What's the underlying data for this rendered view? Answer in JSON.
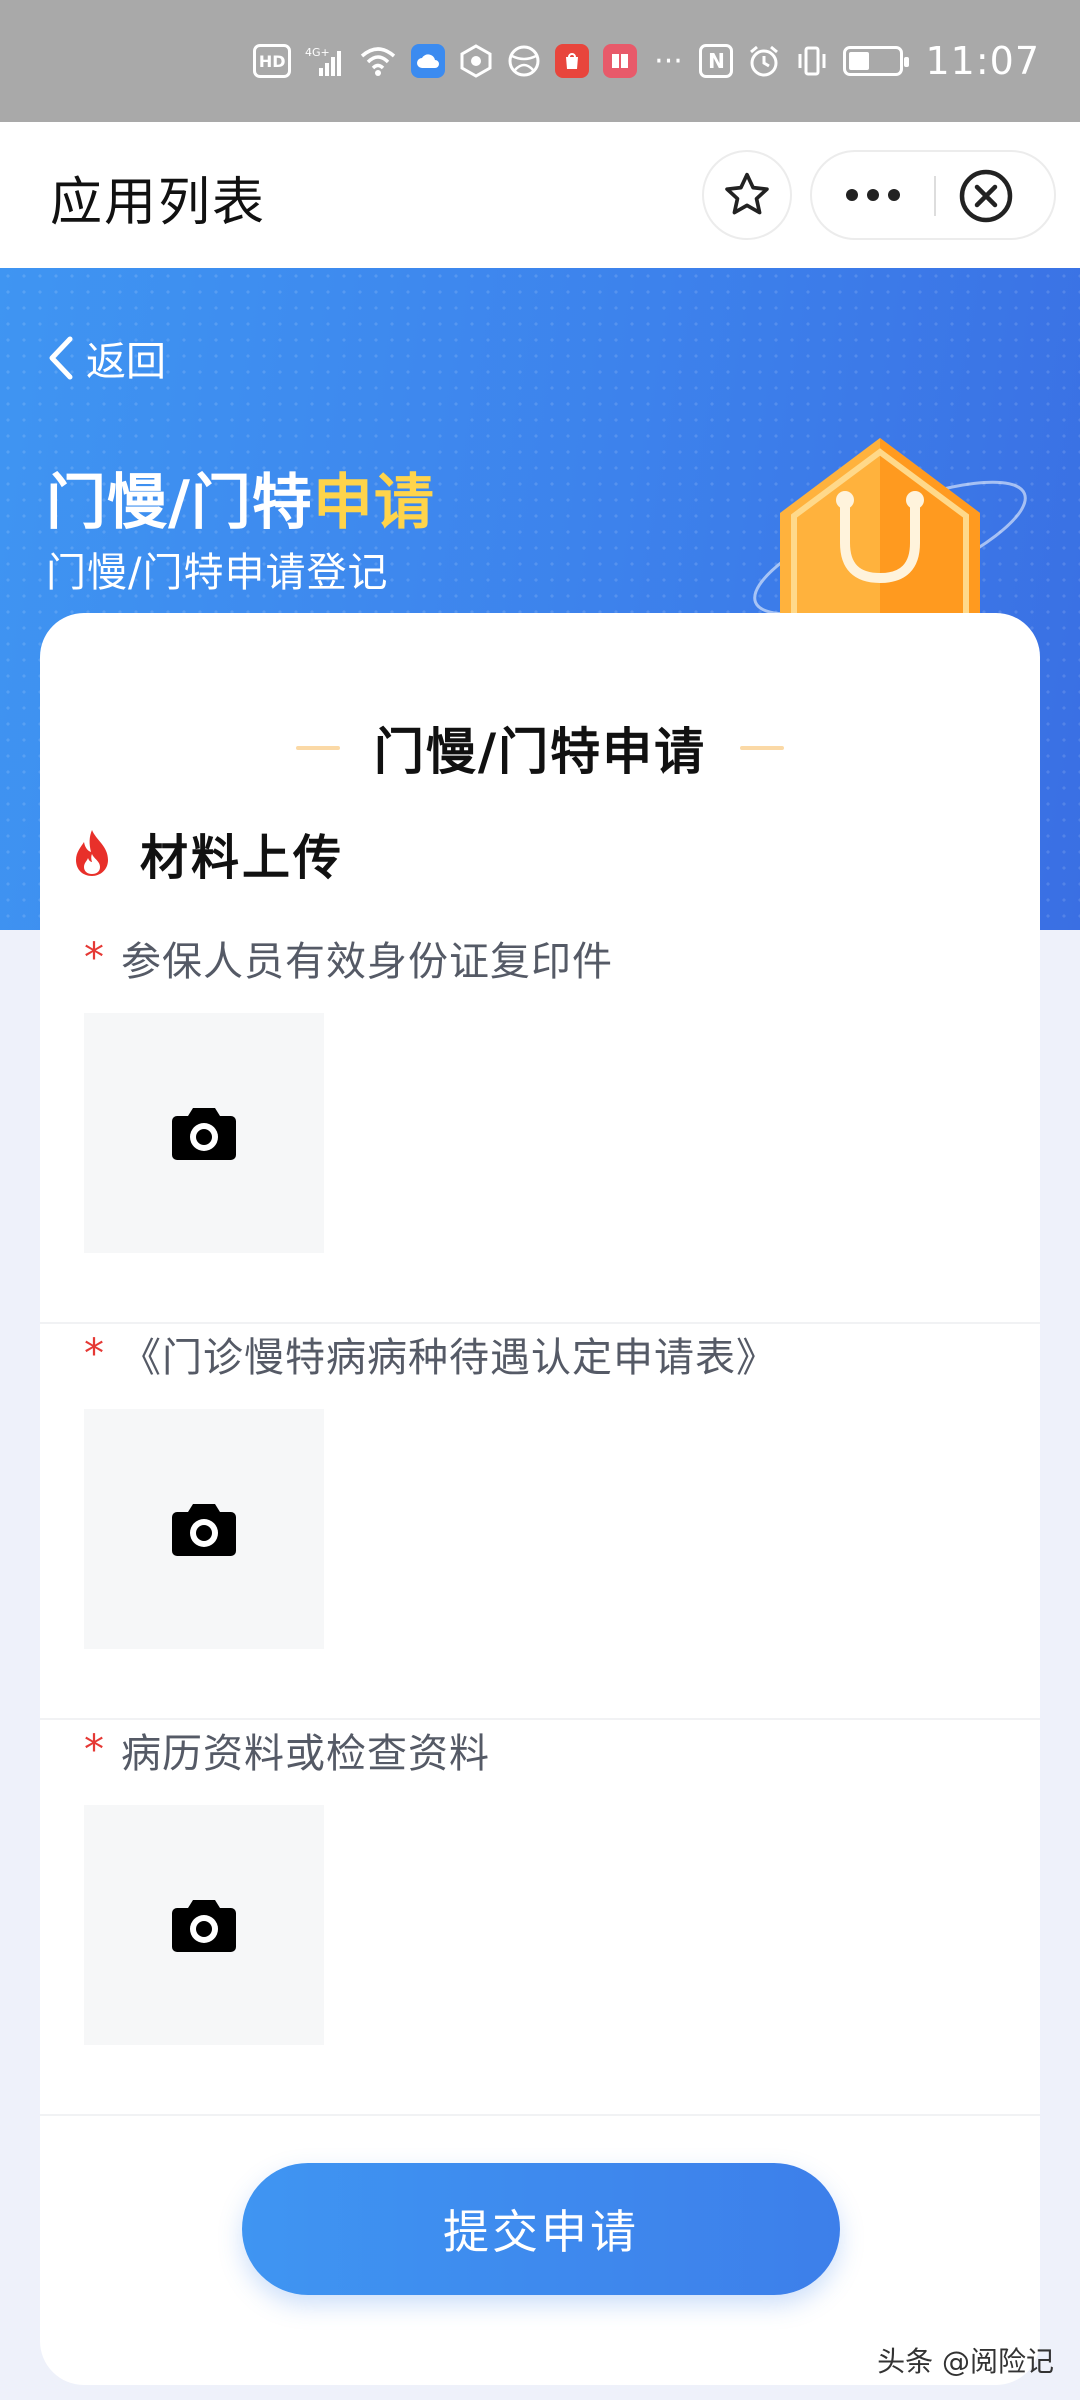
{
  "status_bar": {
    "hd": "HD",
    "network": "4G+",
    "time": "11:07",
    "overflow": "···",
    "nfc": "N"
  },
  "nav": {
    "title": "应用列表"
  },
  "header": {
    "back_label": "返回",
    "title_main": "门慢/门特",
    "title_highlight": "申请",
    "subtitle": "门慢/门特申请登记"
  },
  "card": {
    "title": "门慢/门特申请",
    "section_title": "材料上传",
    "uploads": [
      {
        "required_mark": "*",
        "label": "参保人员有效身份证复印件"
      },
      {
        "required_mark": "*",
        "label": "《门诊慢特病病种待遇认定申请表》"
      },
      {
        "required_mark": "*",
        "label": "病历资料或检查资料"
      }
    ],
    "submit_label": "提交申请"
  },
  "watermark": "头条 @阅险记",
  "colors": {
    "primary_blue": "#3d82ec",
    "highlight_yellow": "#ffd44a",
    "required_red": "#e53935",
    "flame": "#e8302a"
  },
  "icons": [
    "star-icon",
    "more-icon",
    "close-circle-icon",
    "back-chevron-icon",
    "flame-icon",
    "camera-icon"
  ]
}
